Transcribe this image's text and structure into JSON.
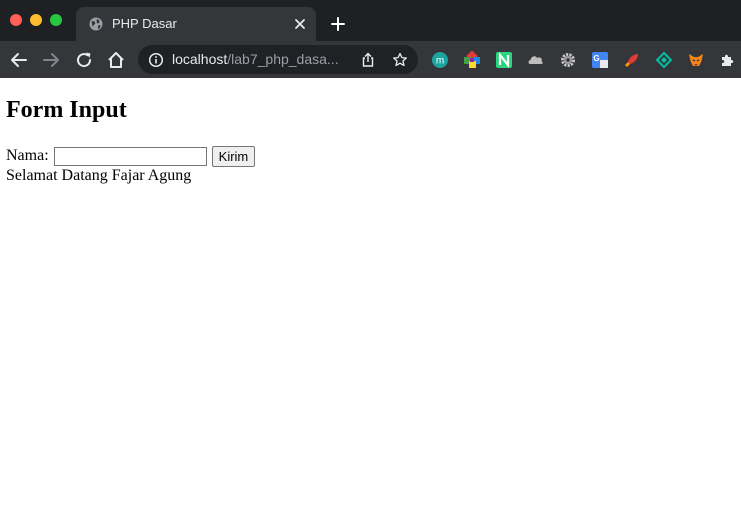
{
  "browser": {
    "tab": {
      "title": "PHP Dasar"
    },
    "address": {
      "host": "localhost",
      "path": "/lab7_php_dasa..."
    },
    "extensions": [
      "m-extension-icon",
      "color-wheel-extension-icon",
      "n-extension-icon",
      "cloud-extension-icon",
      "gear-extension-icon",
      "google-translate-extension-icon",
      "rocket-extension-icon",
      "diamond-extension-icon",
      "metamask-fox-icon",
      "puzzle-icon"
    ],
    "colors": {
      "tabbar": "#1f2023",
      "toolbar": "#35363a",
      "omnibox": "#202124",
      "close": "#fe5f57",
      "minimize": "#febc2e",
      "maximize": "#28c840"
    }
  },
  "page": {
    "heading": "Form Input",
    "form": {
      "label": "Nama:",
      "input_value": "",
      "submit_label": "Kirim"
    },
    "greeting": "Selamat Datang Fajar Agung"
  }
}
